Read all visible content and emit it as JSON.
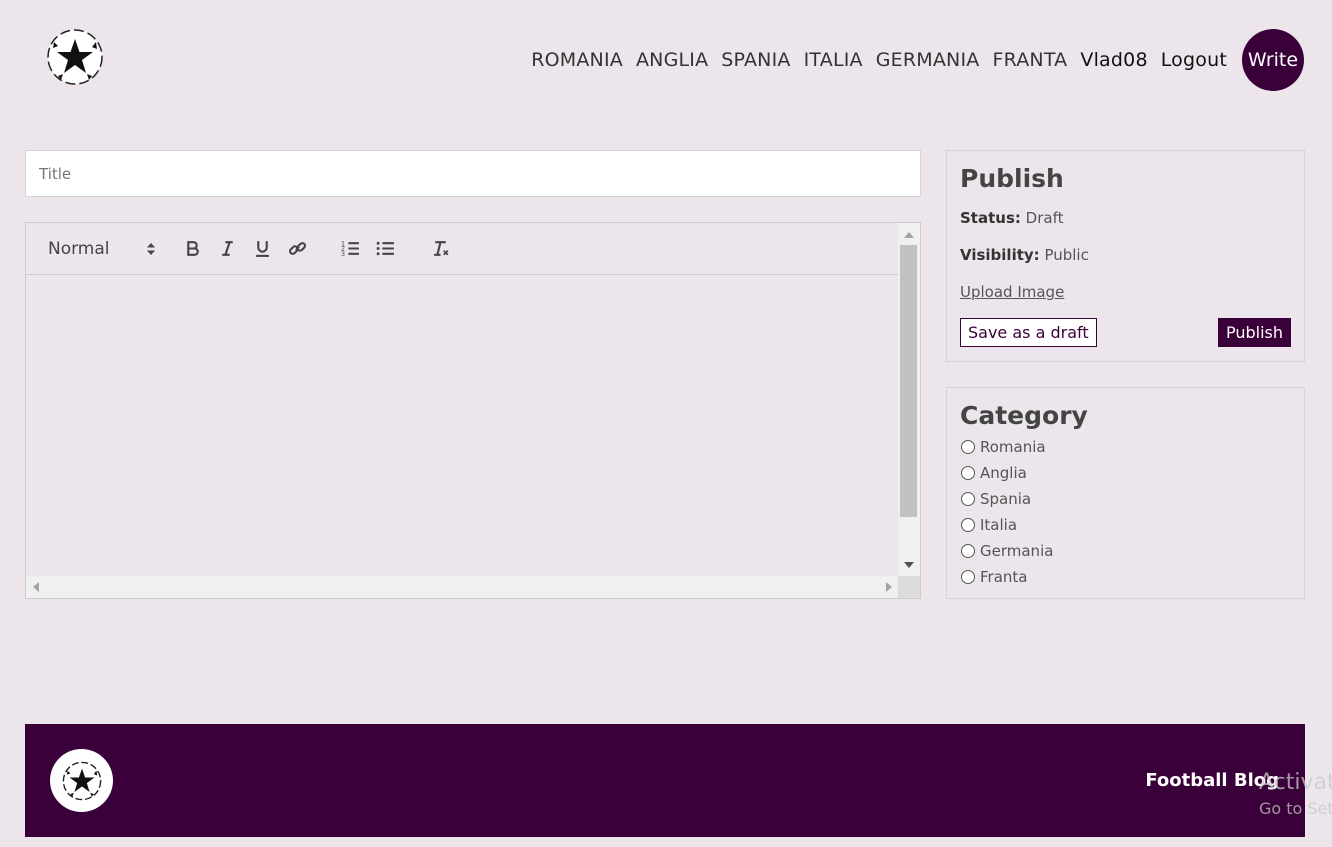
{
  "nav": {
    "links": [
      "ROMANIA",
      "ANGLIA",
      "SPANIA",
      "ITALIA",
      "GERMANIA",
      "FRANTA"
    ],
    "user": "Vlad08",
    "logout": "Logout",
    "write": "Write"
  },
  "editor": {
    "title_placeholder": "Title",
    "format_picker": "Normal",
    "toolbar_icons": [
      "bold-icon",
      "italic-icon",
      "underline-icon",
      "link-icon",
      "ordered-list-icon",
      "bullet-list-icon",
      "clear-format-icon"
    ]
  },
  "publish": {
    "heading": "Publish",
    "status_label": "Status:",
    "status_value": "Draft",
    "visibility_label": "Visibility:",
    "visibility_value": "Public",
    "upload_label": "Upload Image",
    "draft_button": "Save as a draft",
    "publish_button": "Publish"
  },
  "category": {
    "heading": "Category",
    "options": [
      "Romania",
      "Anglia",
      "Spania",
      "Italia",
      "Germania",
      "Franta"
    ]
  },
  "footer": {
    "text": "Football Blog"
  },
  "watermark": {
    "line1": "Activate Windows",
    "line2": "Go to Settings to activate Windows."
  },
  "colors": {
    "background": "#ece6ec",
    "accent": "#3a0039"
  }
}
